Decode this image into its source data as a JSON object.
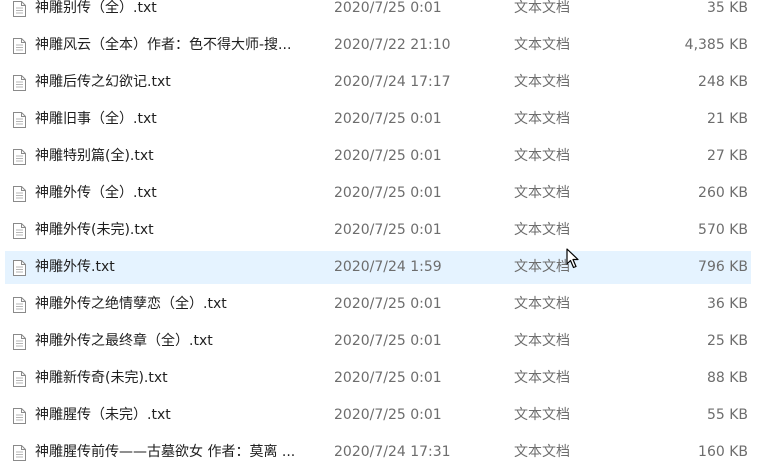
{
  "file_list": {
    "hovered_index": 7,
    "icon": "text-document-icon",
    "files": [
      {
        "name": "神雕别传（全）.txt",
        "date": "2020/7/25 0:01",
        "type": "文本文档",
        "size": "35 KB"
      },
      {
        "name": "神雕风云（全本）作者：色不得大师-搜...",
        "date": "2020/7/22 21:10",
        "type": "文本文档",
        "size": "4,385 KB"
      },
      {
        "name": "神雕后传之幻欲记.txt",
        "date": "2020/7/24 17:17",
        "type": "文本文档",
        "size": "248 KB"
      },
      {
        "name": "神雕旧事（全）.txt",
        "date": "2020/7/25 0:01",
        "type": "文本文档",
        "size": "21 KB"
      },
      {
        "name": "神雕特别篇(全).txt",
        "date": "2020/7/25 0:01",
        "type": "文本文档",
        "size": "27 KB"
      },
      {
        "name": "神雕外传（全）.txt",
        "date": "2020/7/25 0:01",
        "type": "文本文档",
        "size": "260 KB"
      },
      {
        "name": "神雕外传(未完).txt",
        "date": "2020/7/25 0:01",
        "type": "文本文档",
        "size": "570 KB"
      },
      {
        "name": "神雕外传.txt",
        "date": "2020/7/24 1:59",
        "type": "文本文档",
        "size": "796 KB"
      },
      {
        "name": "神雕外传之绝情孽恋（全）.txt",
        "date": "2020/7/25 0:01",
        "type": "文本文档",
        "size": "36 KB"
      },
      {
        "name": "神雕外传之最终章（全）.txt",
        "date": "2020/7/25 0:01",
        "type": "文本文档",
        "size": "25 KB"
      },
      {
        "name": "神雕新传奇(未完).txt",
        "date": "2020/7/25 0:01",
        "type": "文本文档",
        "size": "88 KB"
      },
      {
        "name": "神雕腥传（未完）.txt",
        "date": "2020/7/25 0:01",
        "type": "文本文档",
        "size": "55 KB"
      },
      {
        "name": "神雕腥传前传——古墓欲女 作者：莫离 ...",
        "date": "2020/7/24 17:31",
        "type": "文本文档",
        "size": "160 KB"
      }
    ]
  },
  "colors": {
    "hover_background": "#e5f3ff",
    "name_text": "#1f1f1f",
    "meta_text": "#6d6d6d"
  }
}
